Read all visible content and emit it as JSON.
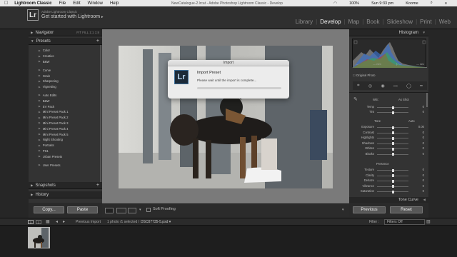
{
  "menubar": {
    "apple": "",
    "app_name": "Lightroom Classic",
    "menus": [
      "File",
      "Edit",
      "Window",
      "Help"
    ],
    "document": "NewCatalogue-2.lrcat - Adobe Photoshop Lightroom Classic - Develop",
    "battery": "100%",
    "clock": "Sun 9:33 pm",
    "user": "Koome"
  },
  "identity": {
    "logo": "Lr",
    "small_text": "Adobe Lightroom Classic",
    "promo": "Get started with Lightroom"
  },
  "modules": [
    {
      "label": "Library",
      "active": false
    },
    {
      "label": "Develop",
      "active": true
    },
    {
      "label": "Map",
      "active": false
    },
    {
      "label": "Book",
      "active": false
    },
    {
      "label": "Slideshow",
      "active": false
    },
    {
      "label": "Print",
      "active": false
    },
    {
      "label": "Web",
      "active": false
    }
  ],
  "left_panel": {
    "navigator": {
      "title": "Navigator",
      "zoom": "FIT  FILL  1:1  1:8"
    },
    "presets": {
      "title": "Presets",
      "groups1": [
        "Color",
        "Creative",
        "B&W"
      ],
      "groups2": [
        "Curve",
        "Grain",
        "Sharpening",
        "Vignetting"
      ],
      "groups3": [
        "Auto Edits",
        "B&W",
        "EV Pack",
        "Mini Preset Pack 1",
        "Mini Preset Pack 2",
        "Mini Preset Pack 3",
        "Mini Preset Pack 4",
        "Mini Preset Pack 5",
        "Night Shooting",
        "Portraits",
        "PS1",
        "Urban Presets"
      ],
      "groups4": [
        "User Presets"
      ]
    },
    "snapshots": "Snapshots",
    "history": "History",
    "copy_label": "Copy...",
    "paste_label": "Paste"
  },
  "dialog": {
    "title": "Import",
    "icon": "Lr",
    "heading": "Import Preset",
    "message": "Please wait until the import is complete..."
  },
  "toolbar": {
    "soft_proofing": "Soft Proofing"
  },
  "right_panel": {
    "histogram_title": "Histogram",
    "readout": [
      "—",
      "— mm",
      "ƒ/ —",
      "— sec"
    ],
    "original_photo": "Original Photo",
    "wb_label": "WB :",
    "wb_value": "As Shot",
    "tone": "Tone",
    "auto": "Auto",
    "sliders_wb": [
      {
        "label": "Temp",
        "value": "0",
        "pos": 0.5
      },
      {
        "label": "Tint",
        "value": "0",
        "pos": 0.5
      }
    ],
    "sliders_tone": [
      {
        "label": "Exposure",
        "value": "0.00",
        "pos": 0.5
      },
      {
        "label": "Contrast",
        "value": "0",
        "pos": 0.5
      },
      {
        "label": "Highlights",
        "value": "0",
        "pos": 0.5
      },
      {
        "label": "Shadows",
        "value": "0",
        "pos": 0.5
      },
      {
        "label": "Whites",
        "value": "0",
        "pos": 0.5
      },
      {
        "label": "Blacks",
        "value": "0",
        "pos": 0.5
      }
    ],
    "presence": "Presence",
    "sliders_presence": [
      {
        "label": "Texture",
        "value": "0",
        "pos": 0.5
      },
      {
        "label": "Clarity",
        "value": "0",
        "pos": 0.5
      },
      {
        "label": "Dehaze",
        "value": "0",
        "pos": 0.5
      },
      {
        "label": "Vibrance",
        "value": "0",
        "pos": 0.5
      },
      {
        "label": "Saturation",
        "value": "0",
        "pos": 0.5
      }
    ],
    "tone_curve": "Tone Curve",
    "previous_label": "Previous",
    "reset_label": "Reset"
  },
  "filmstrip": {
    "page1": "1",
    "page2": "2",
    "source": "Previous Import",
    "count": "1 photo /1 selected /",
    "filename": "DSC07735-5.psd",
    "filter_label": "Filter :",
    "filter_value": "Filters Off"
  },
  "colors": {
    "accent_active": "#f2f2f2",
    "panel_bg": "#333333",
    "canvas_bg": "#7a7a7a"
  }
}
